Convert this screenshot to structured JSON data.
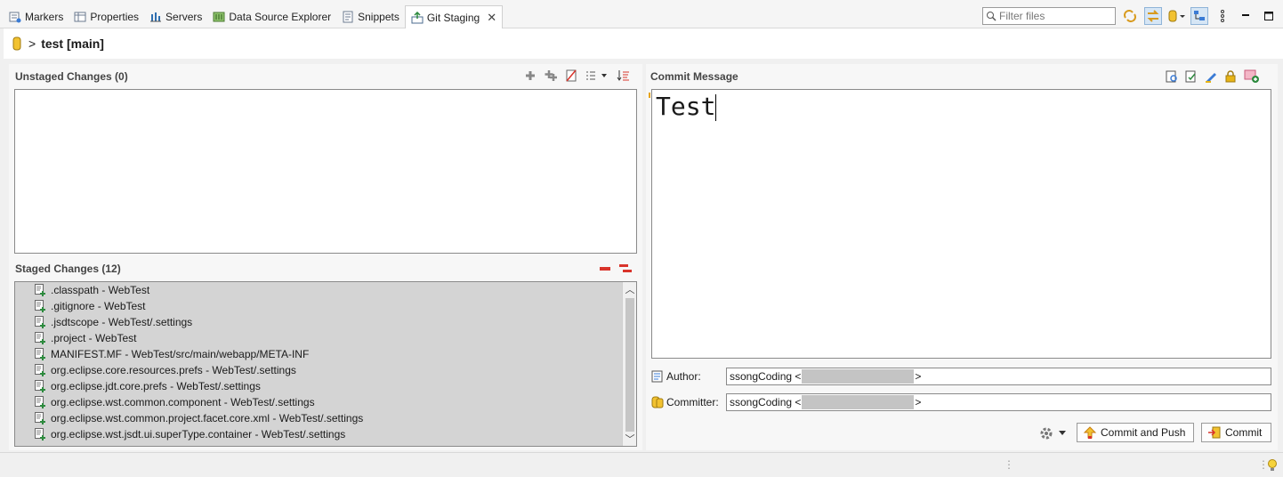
{
  "tabs": [
    {
      "label": "Markers",
      "icon": "markers-icon"
    },
    {
      "label": "Properties",
      "icon": "properties-icon"
    },
    {
      "label": "Servers",
      "icon": "servers-icon"
    },
    {
      "label": "Data Source Explorer",
      "icon": "data-source-icon"
    },
    {
      "label": "Snippets",
      "icon": "snippets-icon"
    },
    {
      "label": "Git Staging",
      "icon": "git-staging-icon",
      "active": true
    }
  ],
  "filter": {
    "placeholder": "Filter files"
  },
  "header": {
    "chevron": ">",
    "repo": "test [main]"
  },
  "unstaged": {
    "title": "Unstaged Changes (0)"
  },
  "staged": {
    "title": "Staged Changes (12)",
    "items": [
      ".classpath - WebTest",
      ".gitignore - WebTest",
      ".jsdtscope - WebTest/.settings",
      ".project - WebTest",
      "MANIFEST.MF - WebTest/src/main/webapp/META-INF",
      "org.eclipse.core.resources.prefs - WebTest/.settings",
      "org.eclipse.jdt.core.prefs - WebTest/.settings",
      "org.eclipse.wst.common.component - WebTest/.settings",
      "org.eclipse.wst.common.project.facet.core.xml - WebTest/.settings",
      "org.eclipse.wst.jsdt.ui.superType.container - WebTest/.settings"
    ]
  },
  "commit": {
    "title": "Commit Message",
    "message": "Test",
    "author_label": "Author:",
    "author_name": "ssongCoding <",
    "author_end": ">",
    "committer_label": "Committer:",
    "committer_name": "ssongCoding <",
    "committer_end": ">",
    "commit_push_label": "Commit and Push",
    "commit_label": "Commit"
  },
  "colors": {
    "accent": "#d6e6f5",
    "staged_bg": "#d4d4d4",
    "remove_red": "#d9342b"
  }
}
